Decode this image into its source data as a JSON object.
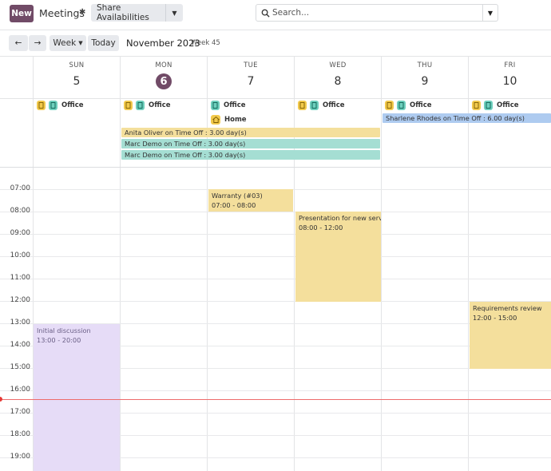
{
  "topbar": {
    "new_label": "New",
    "title": "Meetings",
    "share_label": "Share Availabilities",
    "search_placeholder": "Search..."
  },
  "controls": {
    "prev": "←",
    "next": "→",
    "view": "Week",
    "today": "Today",
    "month_label": "November 2023",
    "week_label": "Week 45"
  },
  "days": [
    {
      "name": "SUN",
      "num": "5",
      "work": "Office",
      "home": ""
    },
    {
      "name": "MON",
      "num": "6",
      "work": "Office",
      "home": ""
    },
    {
      "name": "TUE",
      "num": "7",
      "work": "Office",
      "home": "Home"
    },
    {
      "name": "WED",
      "num": "8",
      "work": "Office",
      "home": ""
    },
    {
      "name": "THU",
      "num": "9",
      "work": "Office",
      "home": ""
    },
    {
      "name": "FRI",
      "num": "10",
      "work": "Office",
      "home": ""
    }
  ],
  "all_day_events": [
    {
      "label": "Anita Oliver on Time Off : 3.00 day(s)",
      "color": "#f4df9c"
    },
    {
      "label": "Marc Demo on Time Off : 3.00 day(s)",
      "color": "#a5ded3"
    },
    {
      "label": "Marc Demo on Time Off : 3.00 day(s)",
      "color": "#a5ded3"
    },
    {
      "label": "Sharlene Rhodes on Time Off : 6.00 day(s)",
      "color": "#aecbf0"
    }
  ],
  "hours": [
    "07:00",
    "08:00",
    "09:00",
    "10:00",
    "11:00",
    "12:00",
    "13:00",
    "14:00",
    "15:00",
    "16:00",
    "17:00",
    "18:00",
    "19:00"
  ],
  "events": [
    {
      "title": "Warranty (#03)",
      "time": "07:00 - 08:00",
      "color": "#f4df9c"
    },
    {
      "title": "Presentation for new serv...",
      "time": "08:00 - 12:00",
      "color": "#f4df9c"
    },
    {
      "title": "Requirements review",
      "time": "12:00 - 15:00",
      "color": "#f4df9c"
    },
    {
      "title": "Initial discussion",
      "time": "13:00 - 20:00",
      "color": "#e6dcf7"
    }
  ],
  "colors": {
    "brand": "#714b67",
    "now_line": "#ee6b6b"
  }
}
